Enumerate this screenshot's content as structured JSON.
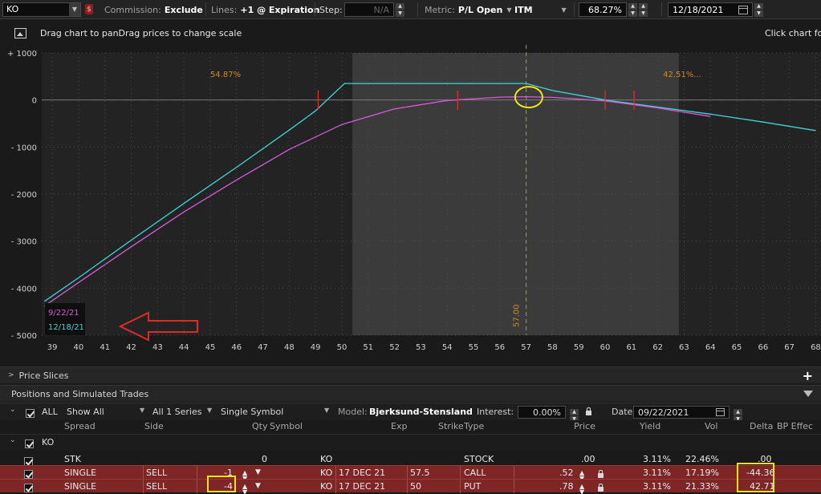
{
  "toolbar": {
    "symbol": "KO",
    "commission_label": "Commission:",
    "commission_value": "Exclude",
    "lines_label": "Lines:",
    "lines_value": "+1 @ Expiration",
    "step_label": "Step:",
    "step_placeholder": "N/A",
    "metric_label": "Metric:",
    "metric_value": "P/L Open",
    "itm_label": "ITM",
    "itm_percent": "68.27%",
    "date": "12/18/2021"
  },
  "chart_header": {
    "hint_left": "Drag chart to panDrag prices to change scale",
    "hint_right": "Click chart for"
  },
  "chart_data": {
    "type": "line",
    "x_ticks": [
      39,
      40,
      41,
      42,
      43,
      44,
      45,
      46,
      47,
      48,
      49,
      50,
      51,
      52,
      53,
      54,
      55,
      56,
      57,
      58,
      59,
      60,
      61,
      62,
      63,
      64,
      65,
      66,
      67,
      68
    ],
    "y_ticks": [
      1000,
      0,
      -1000,
      -2000,
      -3000,
      -4000,
      -5000
    ],
    "y_tick_labels": [
      "+ 1000",
      "0",
      "- 1000",
      "- 2000",
      "- 3000",
      "- 4000",
      "- 5000"
    ],
    "xlim": [
      38.6,
      68.2
    ],
    "ylim": [
      -5000,
      1000
    ],
    "shaded_range": [
      50.4,
      62.8
    ],
    "current_price": 57.0,
    "current_price_label": "57.00",
    "prob_left_label": "54.87%",
    "prob_right_label": "42.51%...",
    "series": [
      {
        "name": "12/18/21",
        "color": "#3fd6d6",
        "x": [
          38.7,
          40,
          42,
          44,
          46,
          48,
          49,
          50.1,
          57,
          58,
          60,
          62,
          64,
          66,
          68
        ],
        "y": [
          -4280,
          -3780,
          -2980,
          -2200,
          -1430,
          -640,
          -230,
          350,
          350,
          200,
          0,
          -150,
          -300,
          -470,
          -650
        ]
      },
      {
        "name": "9/22/21",
        "color": "#d85ad8",
        "x": [
          38.7,
          40,
          42,
          44,
          46,
          48,
          50,
          52,
          54,
          56,
          57,
          58,
          60,
          62,
          64
        ],
        "y": [
          -4380,
          -3880,
          -3120,
          -2380,
          -1700,
          -1050,
          -520,
          -190,
          -10,
          60,
          70,
          55,
          -20,
          -170,
          -350
        ]
      }
    ],
    "breakeven_marks": [
      49.1,
      54.4,
      60.0,
      61.1
    ],
    "circle_mark": {
      "x": 57.1,
      "y": 60
    },
    "legend": [
      "9/22/21",
      "12/18/21"
    ]
  },
  "panels": {
    "price_slices": "Price Slices",
    "positions": "Positions and Simulated Trades"
  },
  "positions_toolbar": {
    "all_label": "ALL",
    "show_all": "Show All",
    "series": "All 1 Series",
    "symbol_mode": "Single Symbol",
    "model_label": "Model:",
    "model_value": "Bjerksund-Stensland",
    "interest_label": "Interest:",
    "interest_value": "0.00%",
    "date_label": "Date:",
    "date_value": "09/22/2021"
  },
  "columns": [
    "Spread",
    "Side",
    "Qty",
    "Symbol",
    "Exp",
    "Strike",
    "Type",
    "Price",
    "Yield",
    "Vol",
    "Delta",
    "BP Effec"
  ],
  "group": {
    "symbol": "KO"
  },
  "rows": [
    {
      "spread": "STK",
      "side": "",
      "qty": "0",
      "symbol": "KO",
      "exp": "",
      "strike": "",
      "type": "STOCK",
      "price": ".00",
      "yield": "3.11%",
      "vol": "22.46%",
      "delta": ".00"
    },
    {
      "spread": "SINGLE",
      "side": "SELL",
      "qty": "-1",
      "symbol": "KO",
      "exp": "17 DEC 21",
      "strike": "57.5",
      "type": "CALL",
      "price": ".52",
      "yield": "3.11%",
      "vol": "17.19%",
      "delta": "-44.36"
    },
    {
      "spread": "SINGLE",
      "side": "SELL",
      "qty": "-4",
      "symbol": "KO",
      "exp": "17 DEC 21",
      "strike": "50",
      "type": "PUT",
      "price": ".78",
      "yield": "3.11%",
      "vol": "21.33%",
      "delta": "42.71"
    }
  ]
}
